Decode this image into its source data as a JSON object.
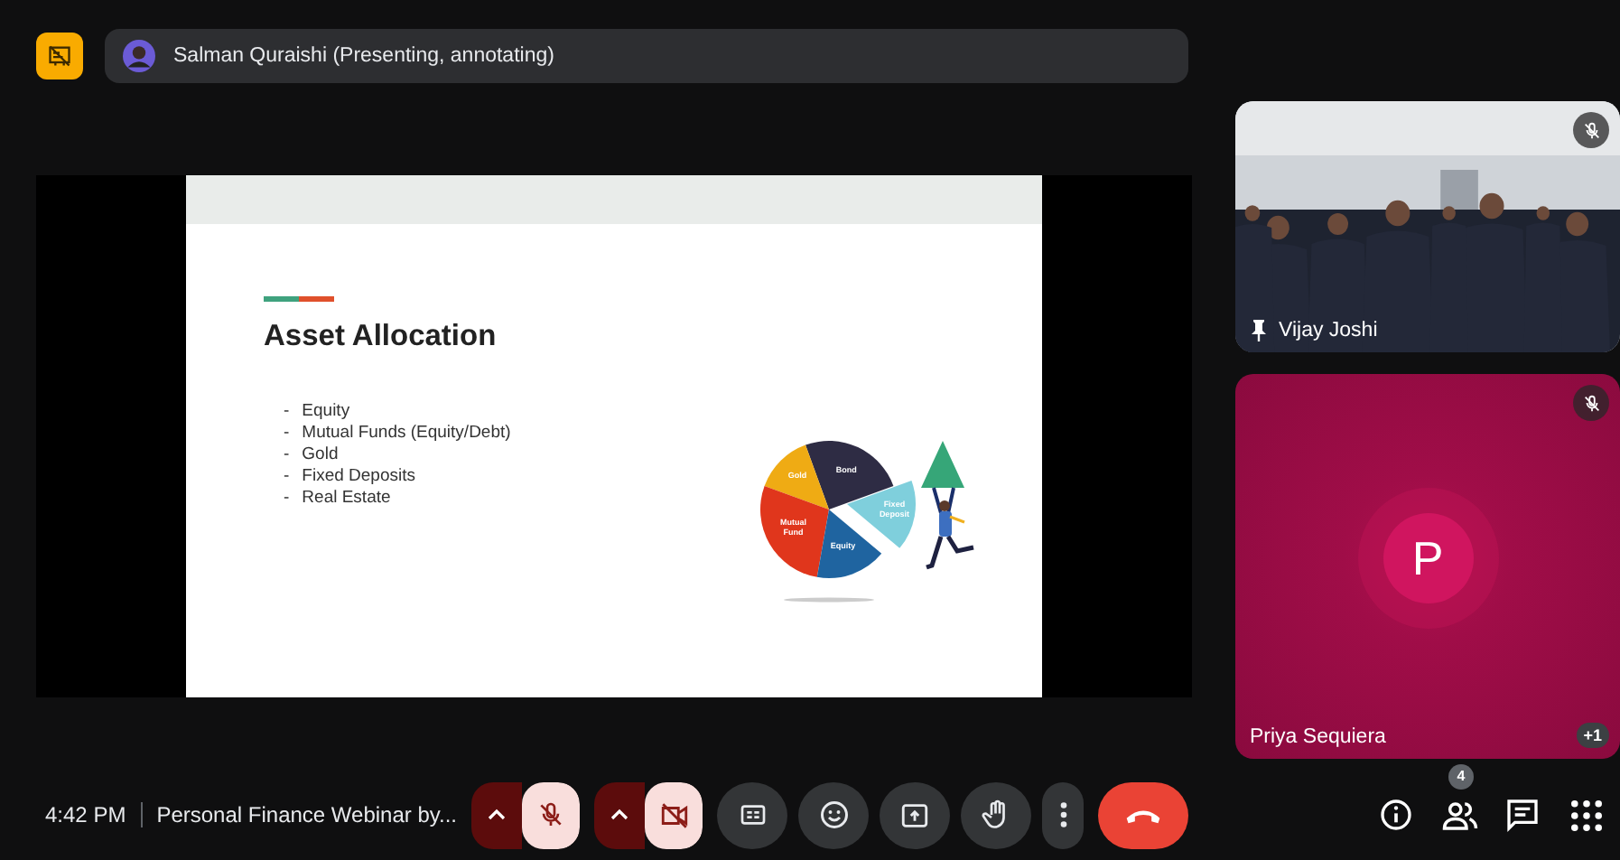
{
  "top_bar": {
    "presenter": "Salman Quraishi (Presenting, annotating)"
  },
  "slide": {
    "title": "Asset Allocation",
    "bullet_mark": "-",
    "bullets": [
      "Equity",
      "Mutual Funds (Equity/Debt)",
      "Gold",
      "Fixed Deposits",
      "Real Estate"
    ],
    "pie_labels": [
      {
        "text": "Bond",
        "color": "#2e2c44"
      },
      {
        "text": "Fixed Deposit",
        "color": "#7fcfdc"
      },
      {
        "text": "Gold",
        "color": "#efab14"
      },
      {
        "text": "Mutual Fund",
        "color": "#e0361c"
      },
      {
        "text": "Equity",
        "color": "#1f64a0"
      }
    ]
  },
  "tiles": [
    {
      "kind": "video",
      "name": "Vijay Joshi",
      "pinned": true,
      "muted": true
    },
    {
      "kind": "avatar",
      "name": "Priya Sequiera",
      "initial": "P",
      "muted": true,
      "more": "+1"
    }
  ],
  "footer": {
    "time": "4:42 PM",
    "meeting_title": "Personal Finance Webinar by...",
    "controls": [
      {
        "kind": "mic",
        "off": true
      },
      {
        "kind": "camera",
        "off": true
      },
      {
        "kind": "captions",
        "off": false
      },
      {
        "kind": "emoji",
        "off": false
      },
      {
        "kind": "present",
        "off": false
      },
      {
        "kind": "hand",
        "off": false
      },
      {
        "kind": "more",
        "off": false
      },
      {
        "kind": "leave",
        "off": false
      }
    ],
    "side": [
      {
        "kind": "info"
      },
      {
        "kind": "people",
        "badge": "4"
      },
      {
        "kind": "chat"
      },
      {
        "kind": "apps"
      }
    ]
  }
}
